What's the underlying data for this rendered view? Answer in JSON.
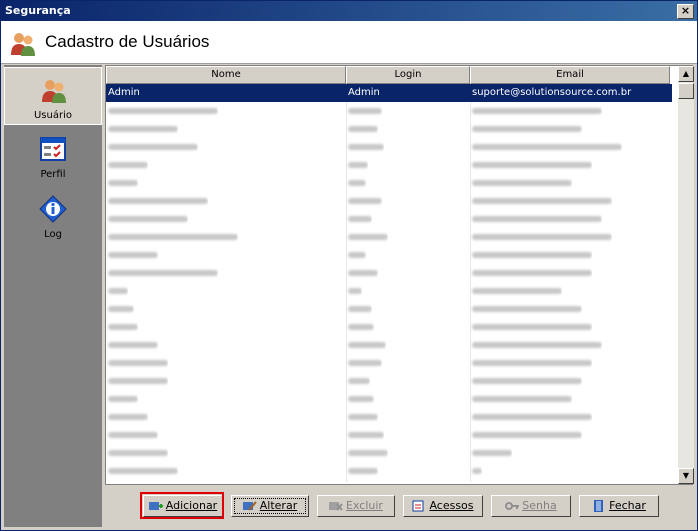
{
  "window": {
    "title": "Segurança",
    "close": "×"
  },
  "header": {
    "title": "Cadastro de Usuários"
  },
  "sidebar": {
    "items": [
      {
        "label": "Usuário",
        "icon": "users-icon",
        "active": true
      },
      {
        "label": "Perfil",
        "icon": "profile-checklist-icon",
        "active": false
      },
      {
        "label": "Log",
        "icon": "info-log-icon",
        "active": false
      }
    ]
  },
  "grid": {
    "columns": [
      "Nome",
      "Login",
      "Email"
    ],
    "selected_row": {
      "nome": "Admin",
      "login": "Admin",
      "email": "suporte@solutionsource.com.br"
    },
    "blurred_rows": 21
  },
  "toolbar": {
    "add": "Adicionar",
    "edit": "Alterar",
    "delete": "Excluir",
    "access": "Acessos",
    "password": "Senha",
    "close": "Fechar"
  },
  "colors": {
    "titlebar": "#0a246a",
    "selection": "#0a246a",
    "highlight": "#e00000"
  }
}
